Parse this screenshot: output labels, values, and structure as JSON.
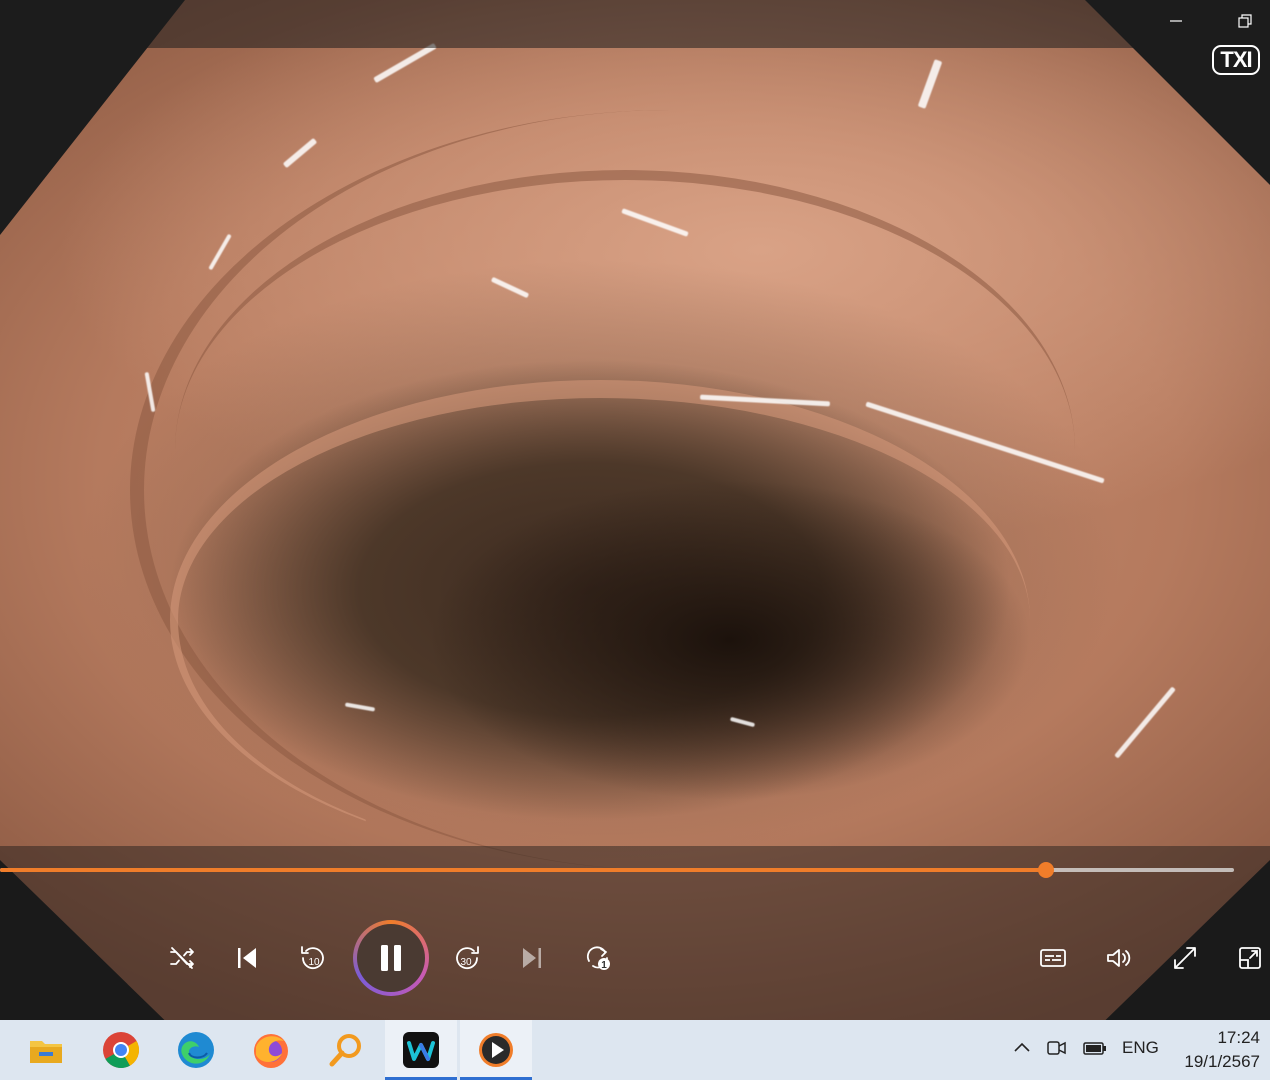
{
  "window": {
    "minimize_icon": "minimize-icon",
    "restore_icon": "restore-icon"
  },
  "video": {
    "overlay_badge": "TXI",
    "progress_fraction": 0.848
  },
  "controls": {
    "buttons": [
      "shuffle-icon",
      "previous-icon",
      "skip-back-10-icon",
      "pause-icon",
      "skip-forward-30-icon",
      "next-icon",
      "repeat-one-icon"
    ],
    "skip_back_label": "10",
    "skip_forward_label": "30",
    "repeat_label": "1",
    "right_buttons": [
      "subtitles-icon",
      "volume-icon",
      "fullscreen-icon",
      "mini-player-icon"
    ],
    "accent_color": "#f07d2a"
  },
  "taskbar": {
    "apps": [
      "file-explorer-icon",
      "chrome-icon",
      "edge-icon",
      "firefox-icon",
      "search-magnifier-app-icon",
      "webex-icon",
      "media-player-icon"
    ],
    "tray": {
      "language": "ENG"
    },
    "clock": {
      "time": "17:24",
      "date": "19/1/2567"
    }
  }
}
